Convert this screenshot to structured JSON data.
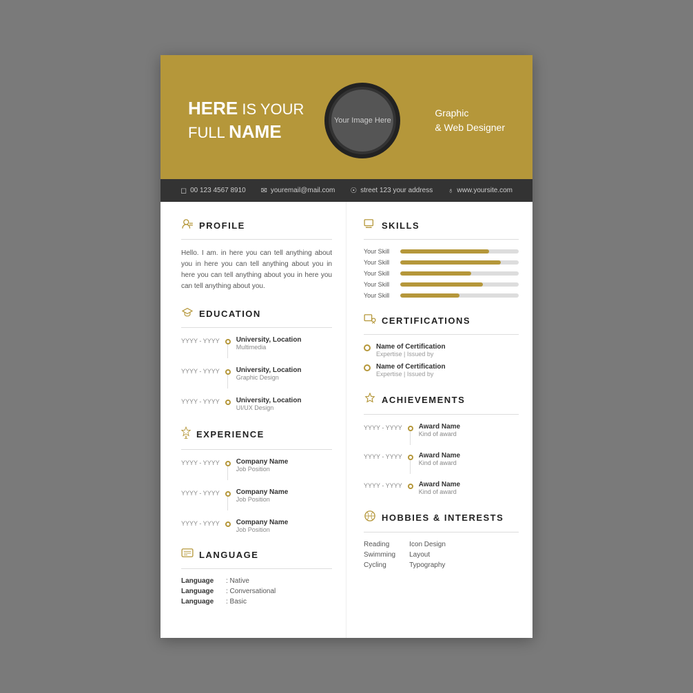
{
  "header": {
    "name_bold": "HERE",
    "name_rest": " IS YOUR\nFULL NAME",
    "photo_label": "Your Image Here",
    "title_line1": "Graphic",
    "title_line2": "& Web Designer"
  },
  "contact": [
    {
      "icon": "📱",
      "text": "00 123 4567 8910"
    },
    {
      "icon": "✉",
      "text": "youremail@mail.com"
    },
    {
      "icon": "📍",
      "text": "street 123 your address"
    },
    {
      "icon": "🌐",
      "text": "www.yoursite.com"
    }
  ],
  "profile": {
    "section_title": "PROFILE",
    "text": "Hello. I am. in here you can tell anything about you in here you can tell anything about you in here you can tell anything about you in here you can tell anything about you."
  },
  "education": {
    "section_title": "EDUCATION",
    "items": [
      {
        "date": "YYYY - YYYY",
        "title": "University, Location",
        "sub": "Multimedia"
      },
      {
        "date": "YYYY - YYYY",
        "title": "University, Location",
        "sub": "Graphic Design"
      },
      {
        "date": "YYYY - YYYY",
        "title": "University, Location",
        "sub": "UI/UX Design"
      }
    ]
  },
  "experience": {
    "section_title": "EXPERIENCE",
    "items": [
      {
        "date": "YYYY - YYYY",
        "title": "Company Name",
        "sub": "Job Position"
      },
      {
        "date": "YYYY - YYYY",
        "title": "Company Name",
        "sub": "Job Position"
      },
      {
        "date": "YYYY - YYYY",
        "title": "Company Name",
        "sub": "Job Position"
      }
    ]
  },
  "language": {
    "section_title": "LANGUAGE",
    "items": [
      {
        "name": "Language",
        "level": ": Native"
      },
      {
        "name": "Language",
        "level": ": Conversational"
      },
      {
        "name": "Language",
        "level": ": Basic"
      }
    ]
  },
  "skills": {
    "section_title": "SKILLS",
    "items": [
      {
        "label": "Your Skill",
        "percent": 75
      },
      {
        "label": "Your Skill",
        "percent": 85
      },
      {
        "label": "Your Skill",
        "percent": 60
      },
      {
        "label": "Your Skill",
        "percent": 70
      },
      {
        "label": "Your Skill",
        "percent": 50
      }
    ]
  },
  "certifications": {
    "section_title": "CERTIFICATIONS",
    "items": [
      {
        "title": "Name of Certification",
        "sub": "Expertise | Issued by"
      },
      {
        "title": "Name of Certification",
        "sub": "Expertise | Issued by"
      }
    ]
  },
  "achievements": {
    "section_title": "ACHIEVEMENTS",
    "items": [
      {
        "date": "YYYY - YYYY",
        "title": "Award Name",
        "sub": "Kind of award"
      },
      {
        "date": "YYYY - YYYY",
        "title": "Award Name",
        "sub": "Kind of award"
      },
      {
        "date": "YYYY - YYYY",
        "title": "Award Name",
        "sub": "Kind of award"
      }
    ]
  },
  "hobbies": {
    "section_title": "HOBBIES & INTERESTS",
    "col1": [
      "Reading",
      "Swimming",
      "Cycling"
    ],
    "col2": [
      "Icon Design",
      "Layout",
      "Typography"
    ]
  }
}
